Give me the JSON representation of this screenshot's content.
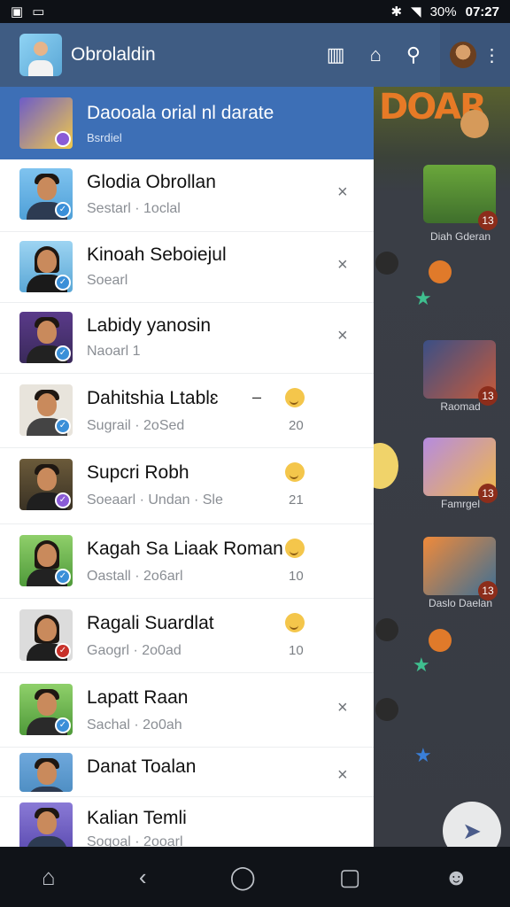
{
  "status_bar": {
    "time": "07:27",
    "battery": "30%"
  },
  "app_bar": {
    "title": "Obrolaldin"
  },
  "drawer_header": {
    "title": "Daooala orial nl darate",
    "subtitle": "Bsrdiel"
  },
  "contacts": [
    {
      "name": "Glodia Obrollan",
      "meta": "Sestarl · 1oclal",
      "trailing": "close",
      "ring": "#3a8fd8"
    },
    {
      "name": "Kinoah Seboiejul",
      "meta": "Soearl",
      "trailing": "close",
      "ring": "#3a8fd8"
    },
    {
      "name": "Labidy yanosin",
      "meta": "Naoarl  1",
      "trailing": "close",
      "ring": "#3a8fd8"
    },
    {
      "name": "Dahitshia Ltablɛ",
      "meta": "Sugrail · 2oSed",
      "trailing": "emoji",
      "count": "20",
      "ring": "#3a8fd8"
    },
    {
      "name": "Supcri Robh",
      "meta": "Soeaarl · Undan · Sle",
      "trailing": "emoji",
      "count": "21",
      "ring": "#8a5bd6"
    },
    {
      "name": "Kagah Sa Liaak Roman",
      "meta": "Oastall · 2o6arl",
      "trailing": "emoji",
      "count": "10",
      "ring": "#3a8fd8"
    },
    {
      "name": "Ragali Suardlat",
      "meta": "Gaogrl · 2o0ad",
      "trailing": "emoji",
      "count": "10",
      "ring": "#c8312a"
    },
    {
      "name": "Lapatt Raan",
      "meta": "Sachal · 2o0ah",
      "trailing": "close",
      "ring": "#3a8fd8"
    },
    {
      "name": "Danat Toalan",
      "meta": "",
      "trailing": "close",
      "ring": "#3a8fd8"
    },
    {
      "name": "Kalian Temli",
      "meta": "Sogoal · 2ooarl",
      "trailing": "none",
      "ring": "#3a8fd8"
    }
  ],
  "game_captions": [
    "Diah Gderan",
    "Raomad",
    "Famrgel",
    "Daslo Daelan"
  ],
  "game_badges": [
    "13",
    "13",
    "13",
    "13"
  ],
  "game_logo": "DOAR",
  "nav": {
    "home": "⌂",
    "back": "‹",
    "circle": "◯",
    "square": "▢",
    "bot": "☻"
  },
  "icons": {
    "close": "×",
    "check": "✓"
  }
}
